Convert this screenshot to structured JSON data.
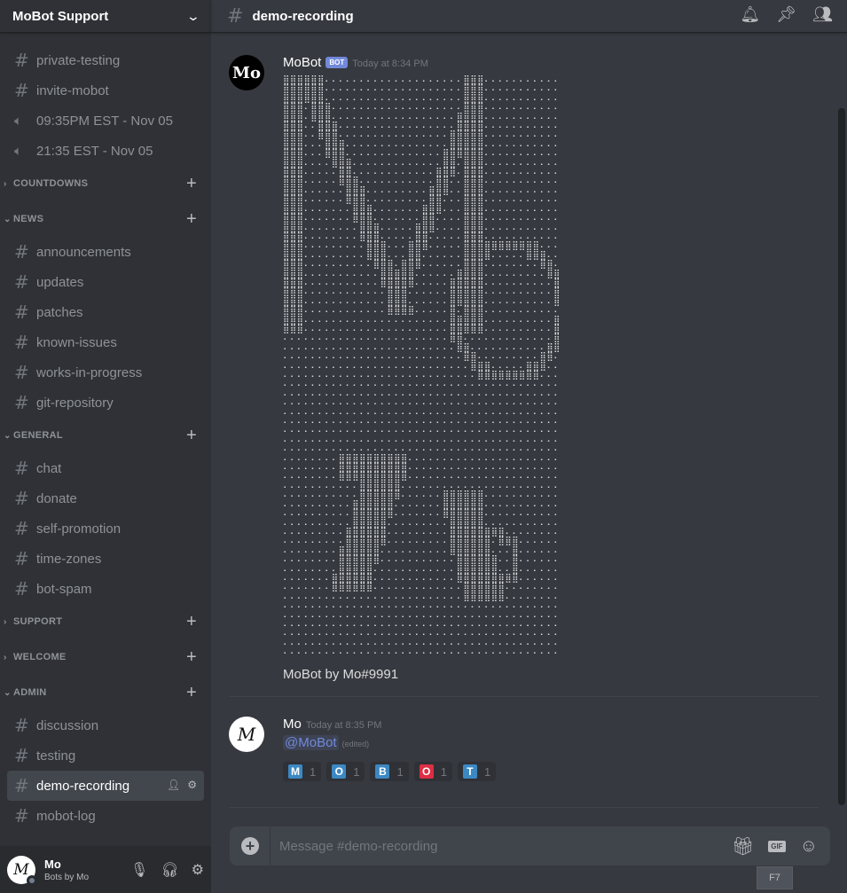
{
  "server": {
    "name": "MoBot Support"
  },
  "channels_top": [
    {
      "name": "private-testing",
      "icon": "hash-icon"
    },
    {
      "name": "invite-mobot",
      "icon": "hash-icon"
    },
    {
      "name": "09:35PM EST - Nov 05",
      "icon": "speaker-icon"
    },
    {
      "name": "21:35 EST - Nov 05",
      "icon": "speaker-icon"
    }
  ],
  "categories": {
    "countdowns": "COUNTDOWNS",
    "news": "NEWS",
    "general": "GENERAL",
    "support": "SUPPORT",
    "welcome": "WELCOME",
    "admin": "ADMIN"
  },
  "news_channels": [
    "announcements",
    "updates",
    "patches",
    "known-issues",
    "works-in-progress",
    "git-repository"
  ],
  "general_channels": [
    "chat",
    "donate",
    "self-promotion",
    "time-zones",
    "bot-spam"
  ],
  "admin_channels": [
    "discussion",
    "testing",
    "demo-recording",
    "mobot-log"
  ],
  "active_channel": "demo-recording",
  "user": {
    "name": "Mo",
    "status": "Bots by Mo"
  },
  "topbar": {
    "channel": "demo-recording"
  },
  "messages": [
    {
      "author": "MoBot",
      "bot_tag": "BOT",
      "timestamp": "Today at 8:34 PM",
      "footer": "MoBot by Mo#9991"
    },
    {
      "author": "Mo",
      "timestamp": "Today at 8:35 PM",
      "mention": "@MoBot",
      "edited": "(edited)",
      "reactions": [
        {
          "letter": "M",
          "count": "1",
          "color": "#3b88c3"
        },
        {
          "letter": "O",
          "count": "1",
          "color": "#3b88c3"
        },
        {
          "letter": "B",
          "count": "1",
          "color": "#3b88c3"
        },
        {
          "letter": "O",
          "count": "1",
          "color": "#dd2e44"
        },
        {
          "letter": "T",
          "count": "1",
          "color": "#3b88c3"
        }
      ]
    }
  ],
  "composer": {
    "placeholder": "Message #demo-recording",
    "gif_label": "GIF",
    "tooltip": "F7"
  },
  "colors": {
    "accent": "#7289da",
    "background": "#36393f",
    "sidebar": "#2f3136"
  }
}
